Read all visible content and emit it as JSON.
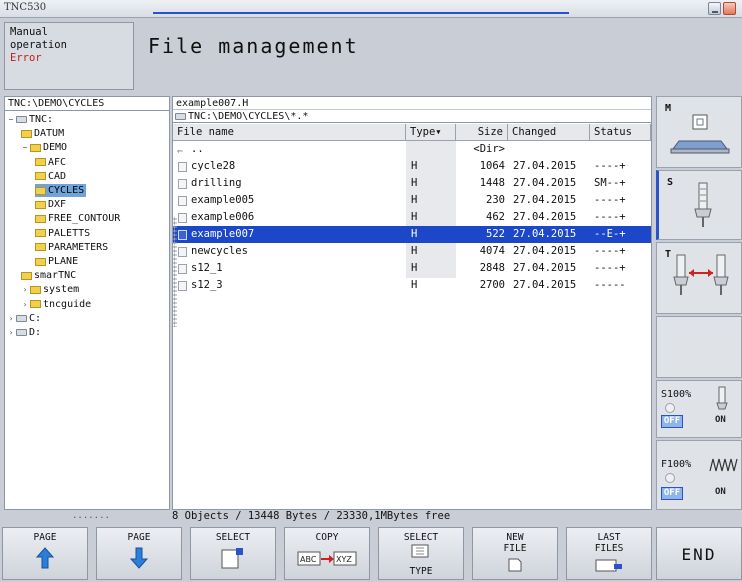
{
  "window": {
    "title": "TNC530"
  },
  "header": {
    "mode_line1": "Manual",
    "mode_line2": "operation",
    "mode_error": "Error",
    "title": "File management"
  },
  "tree": {
    "path": "TNC:\\DEMO\\CYCLES",
    "items": [
      {
        "label": "TNC:",
        "icon": "drive-icon",
        "toggle": "−"
      },
      {
        "label": "DATUM",
        "icon": "folder-icon"
      },
      {
        "label": "DEMO",
        "icon": "folder-icon",
        "toggle": "−"
      },
      {
        "label": "AFC",
        "icon": "folder-icon"
      },
      {
        "label": "CAD",
        "icon": "folder-icon"
      },
      {
        "label": "CYCLES",
        "icon": "folder-icon",
        "selected": true
      },
      {
        "label": "DXF",
        "icon": "folder-icon"
      },
      {
        "label": "FREE_CONTOUR",
        "icon": "folder-icon"
      },
      {
        "label": "PALETTS",
        "icon": "folder-icon"
      },
      {
        "label": "PARAMETERS",
        "icon": "folder-icon"
      },
      {
        "label": "PLANE",
        "icon": "folder-icon"
      },
      {
        "label": "smarTNC",
        "icon": "folder-icon"
      },
      {
        "label": "system",
        "icon": "folder-icon",
        "toggle": "›"
      },
      {
        "label": "tncguide",
        "icon": "folder-icon",
        "toggle": "›"
      },
      {
        "label": "C:",
        "icon": "drive-icon",
        "toggle": "›"
      },
      {
        "label": "D:",
        "icon": "drive-icon",
        "toggle": "›"
      }
    ]
  },
  "files": {
    "selected_name": "example007.H",
    "filter": "TNC:\\DEMO\\CYCLES\\*.*",
    "columns": {
      "name": "File name",
      "type": "Type▾",
      "size": "Size",
      "changed": "Changed",
      "status": "Status"
    },
    "rows": [
      {
        "name": "..",
        "type": "",
        "size": "<Dir>",
        "changed": "",
        "status": "",
        "up": true
      },
      {
        "name": "cycle28",
        "type": "H",
        "size": "1064",
        "changed": "27.04.2015",
        "status": "----+"
      },
      {
        "name": "drilling",
        "type": "H",
        "size": "1448",
        "changed": "27.04.2015",
        "status": "SM--+"
      },
      {
        "name": "example005",
        "type": "H",
        "size": "230",
        "changed": "27.04.2015",
        "status": "----+"
      },
      {
        "name": "example006",
        "type": "H",
        "size": "462",
        "changed": "27.04.2015",
        "status": "----+"
      },
      {
        "name": "example007",
        "type": "H",
        "size": "522",
        "changed": "27.04.2015",
        "status": "--E-+",
        "selected": true
      },
      {
        "name": "newcycles",
        "type": "H",
        "size": "4074",
        "changed": "27.04.2015",
        "status": "----+"
      },
      {
        "name": "s12_1",
        "type": "H",
        "size": "2848",
        "changed": "27.04.2015",
        "status": "----+"
      },
      {
        "name": "s12_3",
        "type": "H",
        "size": "2700",
        "changed": "27.04.2015",
        "status": "-----"
      }
    ]
  },
  "status": {
    "dots": ".......",
    "summary": "8 Objects / 13448 Bytes / 23330,1MBytes free"
  },
  "right_panel": {
    "m_label": "M",
    "s_label": "S",
    "t_label": "T",
    "s_override": "S100%",
    "f_override": "F100%",
    "off": "OFF",
    "on": "ON"
  },
  "softkeys": [
    {
      "l1": "PAGE",
      "l2": "",
      "icon": "arrow-up-icon"
    },
    {
      "l1": "PAGE",
      "l2": "",
      "icon": "arrow-down-icon"
    },
    {
      "l1": "SELECT",
      "l2": "",
      "icon": "select-file-icon"
    },
    {
      "l1": "COPY",
      "l2": "",
      "icon": "copy-abc-xyz-icon",
      "sub": "ABC",
      "sub2": "XYZ"
    },
    {
      "l1": "SELECT",
      "l2": "TYPE",
      "icon": "select-type-icon"
    },
    {
      "l1": "NEW",
      "l2": "FILE",
      "icon": "new-file-icon"
    },
    {
      "l1": "LAST",
      "l2": "FILES",
      "icon": "last-files-icon"
    }
  ],
  "end_key": "END",
  "colors": {
    "selection": "#1c47c8",
    "tree_selection": "#6fa3d9",
    "error": "#c0201a",
    "folder": "#f2cf4c"
  }
}
